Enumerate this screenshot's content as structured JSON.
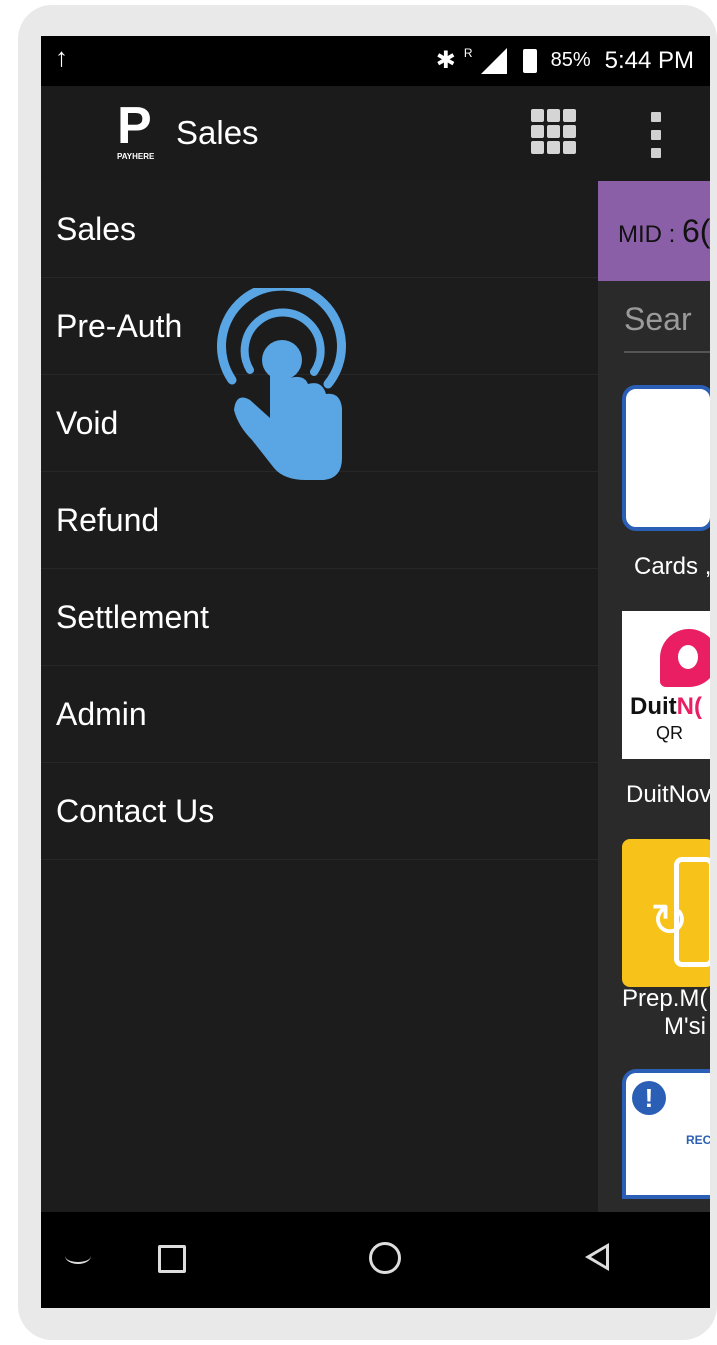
{
  "status_bar": {
    "upload_icon": "upload-arrow-icon",
    "roaming_indicator": "R",
    "battery_percent": "85%",
    "time": "5:44 PM"
  },
  "toolbar": {
    "logo_text": "PAYHERE",
    "title": "Sales",
    "grid_icon": "apps-grid-icon",
    "overflow_icon": "more-vert-icon"
  },
  "drawer": {
    "items": [
      {
        "label": "Sales"
      },
      {
        "label": "Pre-Auth"
      },
      {
        "label": "Void"
      },
      {
        "label": "Refund"
      },
      {
        "label": "Settlement"
      },
      {
        "label": "Admin"
      },
      {
        "label": "Contact Us"
      }
    ]
  },
  "background": {
    "mid_label": "MID :",
    "mid_value": "6(",
    "search_placeholder": "Sear",
    "tiles": [
      {
        "label": "Cards ,"
      },
      {
        "label": "DuitNov",
        "logo_text_a": "Duit",
        "logo_text_b": "N(",
        "logo_sub": "QR"
      },
      {
        "label_line1": "Prep.M(",
        "label_line2": "M'si"
      },
      {
        "badge": "REC"
      }
    ]
  },
  "colors": {
    "accent_purple": "#8b5fa8",
    "drawer_bg": "#1c1c1c",
    "tap_icon_blue": "#5aa5e3"
  },
  "overlay": {
    "tap_icon": "tap-gesture-icon"
  }
}
